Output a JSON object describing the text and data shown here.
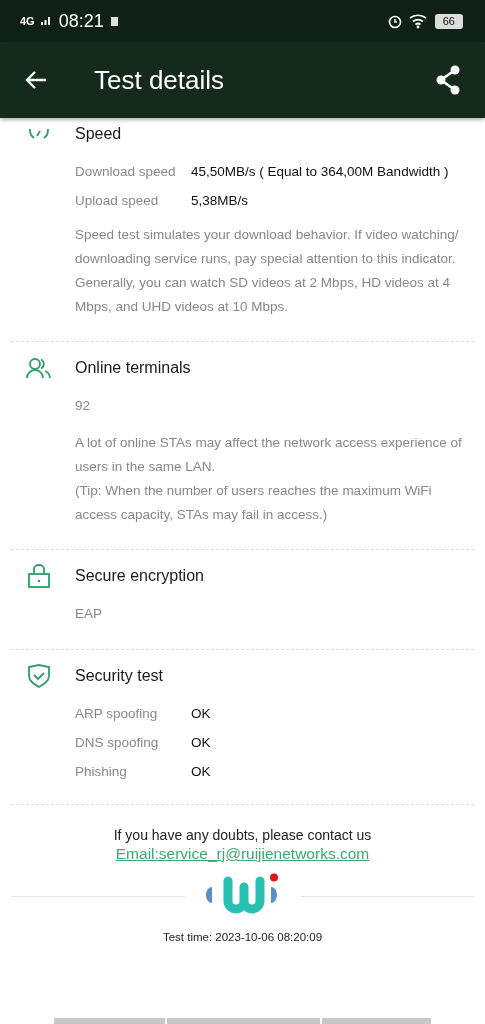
{
  "status_bar": {
    "network": "4G",
    "time": "08:21",
    "battery": "66"
  },
  "app_bar": {
    "title": "Test details"
  },
  "sections": [
    {
      "kind": "speed",
      "title": "Speed",
      "rows": [
        {
          "label": "Download speed",
          "value": "45,50MB/s ( Equal to 364,00M Bandwidth )"
        },
        {
          "label": "Upload speed",
          "value": "5,38MB/s"
        }
      ],
      "notes": [
        "Speed test simulates your download behavior. If video watching/ downloading service runs, pay special attention to this indicator. Generally, you can watch SD videos at 2 Mbps, HD videos at 4 Mbps, and UHD videos at 10 Mbps."
      ]
    },
    {
      "kind": "users",
      "title": "Online terminals",
      "value": "92",
      "notes": [
        "A lot of online STAs may affect the network access experience of users in the same LAN.",
        "(Tip: When the number of users reaches the maximum WiFi access capacity, STAs may fail in access.)"
      ]
    },
    {
      "kind": "lock",
      "title": "Secure encryption",
      "value": "EAP"
    },
    {
      "kind": "shield",
      "title": "Security test",
      "rows": [
        {
          "label": "ARP spoofing",
          "value": "OK"
        },
        {
          "label": "DNS spoofing",
          "value": "OK"
        },
        {
          "label": "Phishing",
          "value": "OK"
        }
      ]
    }
  ],
  "contact": {
    "text": "If you have any doubts, please contact us",
    "email": "Email:service_rj@ruijienetworks.com"
  },
  "test_time": "Test time: 2023-10-06 08:20:09"
}
